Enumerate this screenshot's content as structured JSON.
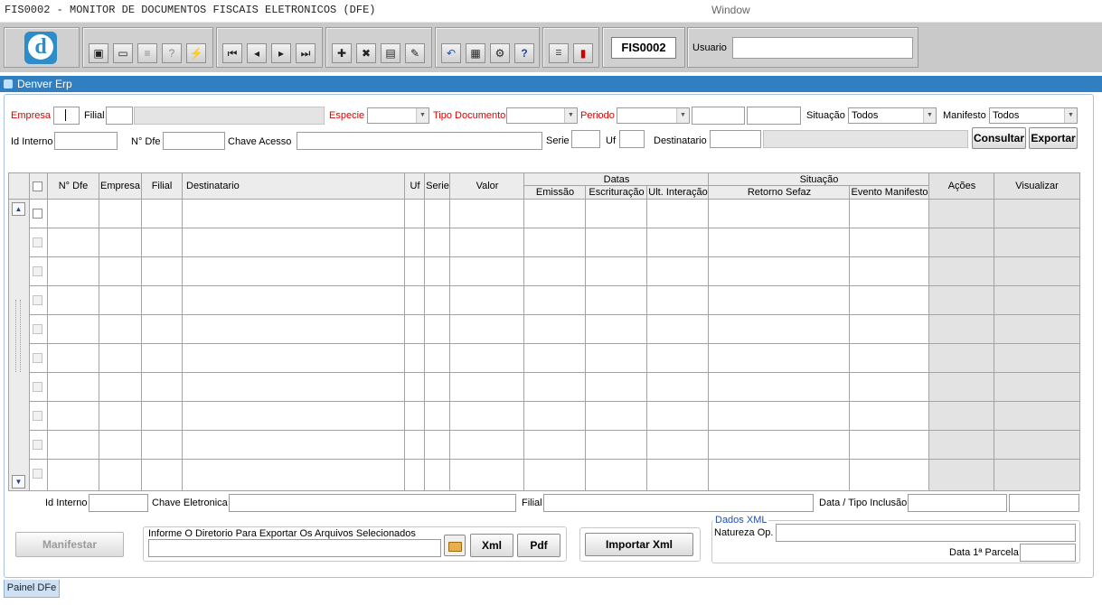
{
  "window": {
    "title": "FIS0002 - MONITOR DE DOCUMENTOS FISCAIS ELETRONICOS (DFE)",
    "title_right": "Window"
  },
  "toolbar": {
    "logo_letter": "d",
    "form_code": "FIS0002",
    "usuario_label": "Usuario",
    "usuario_value": ""
  },
  "header": {
    "title": "Denver Erp"
  },
  "filters": {
    "empresa_label": "Empresa",
    "filial_label": "Filial",
    "especie_label": "Especie",
    "tipo_documento_label": "Tipo Documento",
    "periodo_label": "Periodo",
    "situacao_label": "Situação",
    "situacao_value": "Todos",
    "manifesto_label": "Manifesto",
    "manifesto_value": "Todos",
    "id_interno_label": "Id Interno",
    "n_dfe_label": "N° Dfe",
    "chave_acesso_label": "Chave Acesso",
    "serie_label": "Serie",
    "uf_label": "Uf",
    "destinatario_label": "Destinatario",
    "consultar_label": "Consultar",
    "exportar_label": "Exportar"
  },
  "table": {
    "columns": {
      "n_dfe": "N° Dfe",
      "empresa": "Empresa",
      "filial": "Filial",
      "destinatario": "Destinatario",
      "uf": "Uf",
      "serie": "Serie",
      "valor": "Valor",
      "datas": "Datas",
      "emissao": "Emissão",
      "escrituracao": "Escrituração",
      "ult_interacao": "Ult. Interação",
      "situacao": "Situação",
      "retorno_sefaz": "Retorno Sefaz",
      "evento_manifesto": "Evento Manifesto",
      "acoes": "Ações",
      "visualizar": "Visualizar"
    },
    "rows": [
      {},
      {},
      {},
      {},
      {},
      {},
      {},
      {},
      {},
      {}
    ]
  },
  "detail": {
    "id_interno_label": "Id Interno",
    "chave_eletronica_label": "Chave Eletronica",
    "filial_label": "Filial",
    "data_tipo_inclusao_label": "Data / Tipo Inclusão"
  },
  "bottom": {
    "manifestar_label": "Manifestar",
    "export_dir_label": "Informe O Diretorio Para Exportar Os Arquivos Selecionados",
    "xml_label": "Xml",
    "pdf_label": "Pdf",
    "importar_xml_label": "Importar Xml",
    "dados_xml_legend": "Dados XML",
    "natureza_op_label": "Natureza Op.",
    "data_parcela_label": "Data 1ª Parcela"
  },
  "tabs": {
    "painel_label": "Painel DFe"
  },
  "colors": {
    "accent_blue": "#2f7fc1",
    "required_red": "#e00000",
    "toolbar_gray": "#c9c9c9"
  }
}
